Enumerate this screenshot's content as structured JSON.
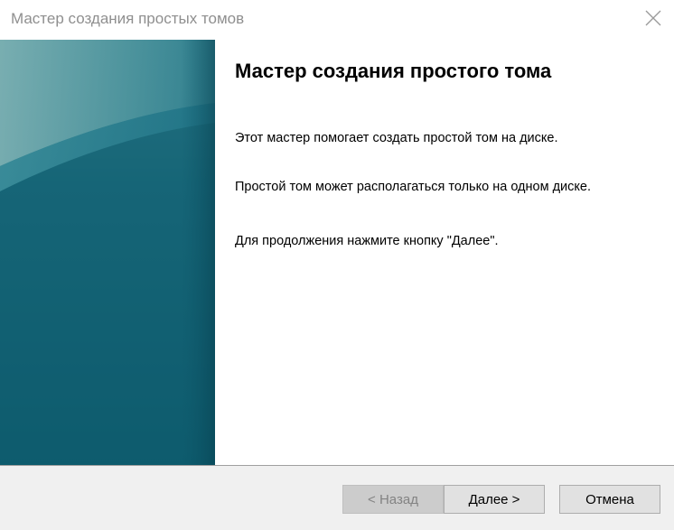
{
  "window": {
    "title": "Мастер создания простых томов"
  },
  "main": {
    "heading": "Мастер создания простого тома",
    "paragraphs": [
      "Этот мастер помогает создать простой том на диске.",
      "Простой том может располагаться только на одном диске.",
      "Для продолжения нажмите кнопку \"Далее\"."
    ]
  },
  "footer": {
    "back_label": "< Назад",
    "next_label": "Далее >",
    "cancel_label": "Отмена"
  },
  "colors": {
    "banner_dark": "#0b5366",
    "banner_light": "#2f8294",
    "disabled_button": "#cccccc",
    "footer_bg": "#f0f0f0"
  }
}
